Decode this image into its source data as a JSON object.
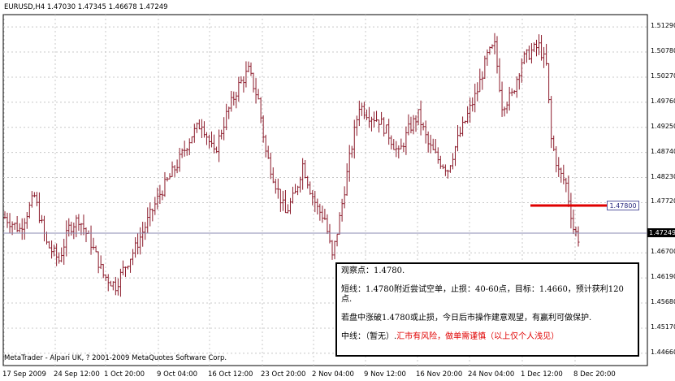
{
  "chart_header": {
    "symbol_line": "EURUSD,H4  1.47030 1.47345 1.46678 1.47249"
  },
  "copyright": "MetaTrader - Alpari UK, ? 2001-2009 MetaQuotes Software Corp.",
  "price_axis": {
    "labels": [
      "1.51290",
      "1.50780",
      "1.50270",
      "1.49760",
      "1.49250",
      "1.48740",
      "1.48230",
      "1.47720",
      "1.46700",
      "1.46190",
      "1.45680",
      "1.45170",
      "1.44660"
    ],
    "current_price": "1.47249"
  },
  "time_axis": {
    "labels": [
      "17 Sep 2009",
      "24 Sep 12:00",
      "1 Oct 20:00",
      "9 Oct 04:00",
      "16 Oct 12:00",
      "23 Oct 20:00",
      "2 Nov 04:00",
      "9 Nov 12:00",
      "16 Nov 20:00",
      "24 Nov 04:00",
      "1 Dec 12:00",
      "8 Dec 20:00"
    ]
  },
  "level_line": {
    "price": "1.47800",
    "color": "#e00000"
  },
  "colors": {
    "bar": "#8b1a2a",
    "grid": "#c8c8c8",
    "current_line": "#8a8ab0"
  },
  "comment": {
    "line1": "观察点：1.4780.",
    "line2": "短线：1.4780附近尝试空单，止损：40-60点，目标：1.4660，预计获利120点.",
    "line3": "若盘中涨破1.4780或止损，今日后市操作建意观望，有赢利可做保护.",
    "line4_prefix": "中线：（暂无）.",
    "line4_risk": "汇市有风险，做单需谨慎（以上仅个人浅见）"
  },
  "chart_data": {
    "type": "ohlc-bar",
    "symbol": "EURUSD",
    "timeframe": "H4",
    "last_bar": {
      "open": 1.4703,
      "high": 1.47345,
      "low": 1.46678,
      "close": 1.47249
    },
    "y_range": [
      1.4441,
      1.5154
    ],
    "horizontal_level": 1.478,
    "close_path": [
      [
        0,
        1.4742
      ],
      [
        6,
        1.4718
      ],
      [
        12,
        1.4785
      ],
      [
        17,
        1.4688
      ],
      [
        22,
        1.4655
      ],
      [
        26,
        1.472
      ],
      [
        30,
        1.474
      ],
      [
        35,
        1.469
      ],
      [
        40,
        1.4625
      ],
      [
        45,
        1.4603
      ],
      [
        48,
        1.4635
      ],
      [
        53,
        1.468
      ],
      [
        58,
        1.4735
      ],
      [
        63,
        1.479
      ],
      [
        70,
        1.485
      ],
      [
        76,
        1.491
      ],
      [
        80,
        1.4935
      ],
      [
        85,
        1.487
      ],
      [
        90,
        1.495
      ],
      [
        95,
        1.501
      ],
      [
        99,
        1.504
      ],
      [
        103,
        1.498
      ],
      [
        106,
        1.4875
      ],
      [
        110,
        1.481
      ],
      [
        114,
        1.475
      ],
      [
        118,
        1.479
      ],
      [
        121,
        1.485
      ],
      [
        124,
        1.48
      ],
      [
        127,
        1.476
      ],
      [
        130,
        1.474
      ],
      [
        133,
        1.466
      ],
      [
        136,
        1.474
      ],
      [
        140,
        1.486
      ],
      [
        144,
        1.497
      ],
      [
        148,
        1.495
      ],
      [
        152,
        1.494
      ],
      [
        156,
        1.491
      ],
      [
        160,
        1.487
      ],
      [
        164,
        1.492
      ],
      [
        168,
        1.495
      ],
      [
        172,
        1.489
      ],
      [
        176,
        1.486
      ],
      [
        180,
        1.484
      ],
      [
        184,
        1.49
      ],
      [
        188,
        1.495
      ],
      [
        192,
        1.5
      ],
      [
        196,
        1.507
      ],
      [
        199,
        1.509
      ],
      [
        202,
        1.497
      ],
      [
        206,
        1.499
      ],
      [
        210,
        1.506
      ],
      [
        214,
        1.508
      ],
      [
        217,
        1.509
      ],
      [
        220,
        1.505
      ],
      [
        222,
        1.49
      ],
      [
        225,
        1.4835
      ],
      [
        228,
        1.481
      ],
      [
        231,
        1.472
      ],
      [
        233,
        1.47
      ]
    ]
  }
}
